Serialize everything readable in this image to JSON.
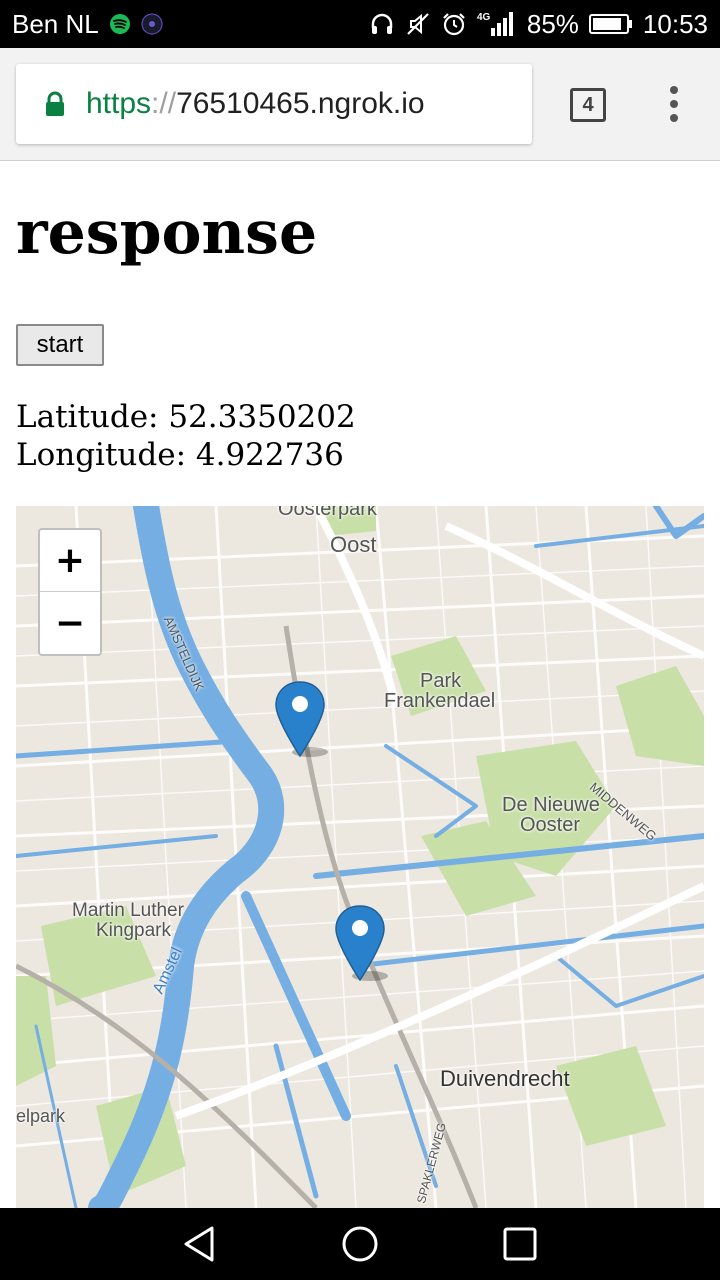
{
  "status_bar": {
    "carrier": "Ben NL",
    "network": "4G",
    "battery": "85%",
    "time": "10:53",
    "icons": [
      "spotify-icon",
      "app-icon",
      "headphones-icon",
      "mute-icon",
      "alarm-icon",
      "signal-icon",
      "battery-icon"
    ]
  },
  "browser": {
    "url_scheme": "https",
    "url_separator": "://",
    "url_host": "76510465.ngrok.io",
    "tab_count": "4"
  },
  "page": {
    "title": "response",
    "start_button": "start",
    "latitude_text": "Latitude: 52.3350202",
    "longitude_text": "Longitude: 4.922736"
  },
  "map": {
    "zoom_in": "+",
    "zoom_out": "−",
    "labels": {
      "oosterpark": "Oosterpark",
      "oost": "Oost",
      "amsteldijk": "AMSTELDIJK",
      "park_frankendael_1": "Park",
      "park_frankendael_2": "Frankendael",
      "nieuwe_ooster_1": "De Nieuwe",
      "nieuwe_ooster_2": "Ooster",
      "middenweg": "MIDDENWEG",
      "martin_luther_1": "Martin Luther",
      "martin_luther_2": "Kingpark",
      "amstel": "Amstel",
      "duivendrecht": "Duivendrecht",
      "elpark": "elpark",
      "spaklerweg": "SPAKLERWEG"
    },
    "colors": {
      "water": "#74aee3",
      "land": "#ece7df",
      "park": "#c8dfa8",
      "marker": "#2a81cb"
    }
  }
}
